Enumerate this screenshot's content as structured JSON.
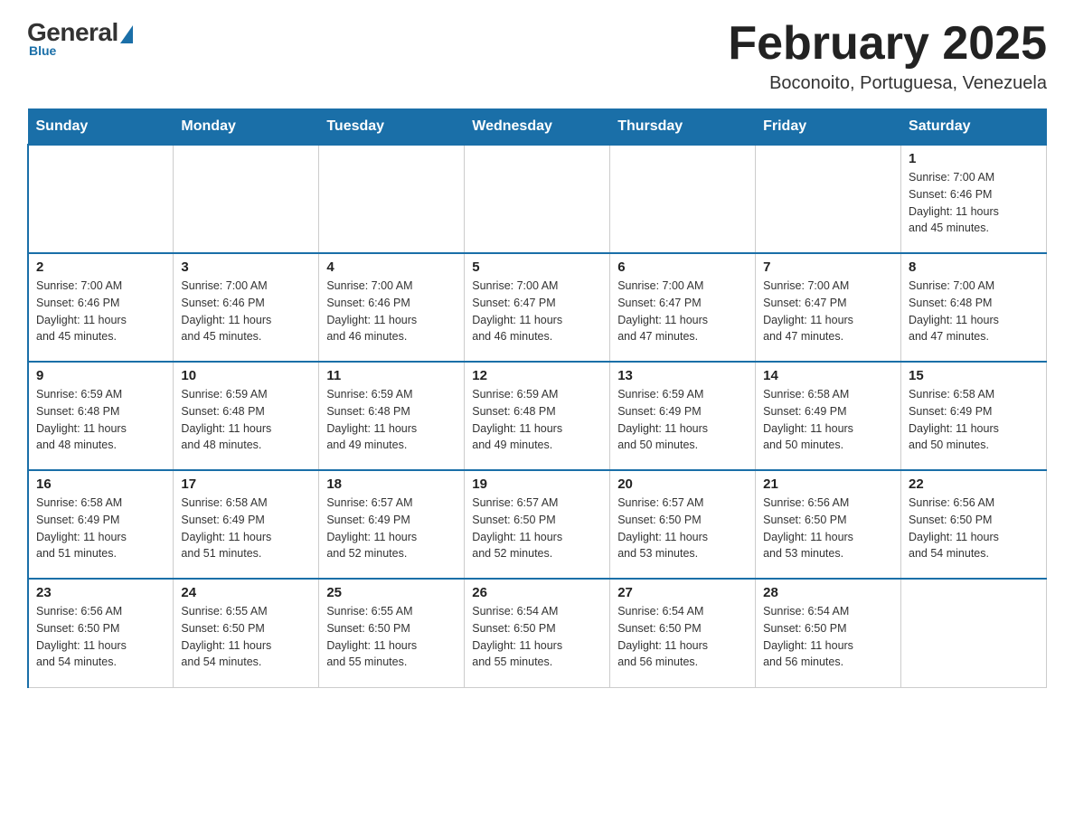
{
  "logo": {
    "general": "General",
    "blue": "Blue",
    "sub": "Blue"
  },
  "title": {
    "month": "February 2025",
    "location": "Boconoito, Portuguesa, Venezuela"
  },
  "weekdays": [
    "Sunday",
    "Monday",
    "Tuesday",
    "Wednesday",
    "Thursday",
    "Friday",
    "Saturday"
  ],
  "weeks": [
    [
      {
        "day": "",
        "info": ""
      },
      {
        "day": "",
        "info": ""
      },
      {
        "day": "",
        "info": ""
      },
      {
        "day": "",
        "info": ""
      },
      {
        "day": "",
        "info": ""
      },
      {
        "day": "",
        "info": ""
      },
      {
        "day": "1",
        "info": "Sunrise: 7:00 AM\nSunset: 6:46 PM\nDaylight: 11 hours\nand 45 minutes."
      }
    ],
    [
      {
        "day": "2",
        "info": "Sunrise: 7:00 AM\nSunset: 6:46 PM\nDaylight: 11 hours\nand 45 minutes."
      },
      {
        "day": "3",
        "info": "Sunrise: 7:00 AM\nSunset: 6:46 PM\nDaylight: 11 hours\nand 45 minutes."
      },
      {
        "day": "4",
        "info": "Sunrise: 7:00 AM\nSunset: 6:46 PM\nDaylight: 11 hours\nand 46 minutes."
      },
      {
        "day": "5",
        "info": "Sunrise: 7:00 AM\nSunset: 6:47 PM\nDaylight: 11 hours\nand 46 minutes."
      },
      {
        "day": "6",
        "info": "Sunrise: 7:00 AM\nSunset: 6:47 PM\nDaylight: 11 hours\nand 47 minutes."
      },
      {
        "day": "7",
        "info": "Sunrise: 7:00 AM\nSunset: 6:47 PM\nDaylight: 11 hours\nand 47 minutes."
      },
      {
        "day": "8",
        "info": "Sunrise: 7:00 AM\nSunset: 6:48 PM\nDaylight: 11 hours\nand 47 minutes."
      }
    ],
    [
      {
        "day": "9",
        "info": "Sunrise: 6:59 AM\nSunset: 6:48 PM\nDaylight: 11 hours\nand 48 minutes."
      },
      {
        "day": "10",
        "info": "Sunrise: 6:59 AM\nSunset: 6:48 PM\nDaylight: 11 hours\nand 48 minutes."
      },
      {
        "day": "11",
        "info": "Sunrise: 6:59 AM\nSunset: 6:48 PM\nDaylight: 11 hours\nand 49 minutes."
      },
      {
        "day": "12",
        "info": "Sunrise: 6:59 AM\nSunset: 6:48 PM\nDaylight: 11 hours\nand 49 minutes."
      },
      {
        "day": "13",
        "info": "Sunrise: 6:59 AM\nSunset: 6:49 PM\nDaylight: 11 hours\nand 50 minutes."
      },
      {
        "day": "14",
        "info": "Sunrise: 6:58 AM\nSunset: 6:49 PM\nDaylight: 11 hours\nand 50 minutes."
      },
      {
        "day": "15",
        "info": "Sunrise: 6:58 AM\nSunset: 6:49 PM\nDaylight: 11 hours\nand 50 minutes."
      }
    ],
    [
      {
        "day": "16",
        "info": "Sunrise: 6:58 AM\nSunset: 6:49 PM\nDaylight: 11 hours\nand 51 minutes."
      },
      {
        "day": "17",
        "info": "Sunrise: 6:58 AM\nSunset: 6:49 PM\nDaylight: 11 hours\nand 51 minutes."
      },
      {
        "day": "18",
        "info": "Sunrise: 6:57 AM\nSunset: 6:49 PM\nDaylight: 11 hours\nand 52 minutes."
      },
      {
        "day": "19",
        "info": "Sunrise: 6:57 AM\nSunset: 6:50 PM\nDaylight: 11 hours\nand 52 minutes."
      },
      {
        "day": "20",
        "info": "Sunrise: 6:57 AM\nSunset: 6:50 PM\nDaylight: 11 hours\nand 53 minutes."
      },
      {
        "day": "21",
        "info": "Sunrise: 6:56 AM\nSunset: 6:50 PM\nDaylight: 11 hours\nand 53 minutes."
      },
      {
        "day": "22",
        "info": "Sunrise: 6:56 AM\nSunset: 6:50 PM\nDaylight: 11 hours\nand 54 minutes."
      }
    ],
    [
      {
        "day": "23",
        "info": "Sunrise: 6:56 AM\nSunset: 6:50 PM\nDaylight: 11 hours\nand 54 minutes."
      },
      {
        "day": "24",
        "info": "Sunrise: 6:55 AM\nSunset: 6:50 PM\nDaylight: 11 hours\nand 54 minutes."
      },
      {
        "day": "25",
        "info": "Sunrise: 6:55 AM\nSunset: 6:50 PM\nDaylight: 11 hours\nand 55 minutes."
      },
      {
        "day": "26",
        "info": "Sunrise: 6:54 AM\nSunset: 6:50 PM\nDaylight: 11 hours\nand 55 minutes."
      },
      {
        "day": "27",
        "info": "Sunrise: 6:54 AM\nSunset: 6:50 PM\nDaylight: 11 hours\nand 56 minutes."
      },
      {
        "day": "28",
        "info": "Sunrise: 6:54 AM\nSunset: 6:50 PM\nDaylight: 11 hours\nand 56 minutes."
      },
      {
        "day": "",
        "info": ""
      }
    ]
  ]
}
